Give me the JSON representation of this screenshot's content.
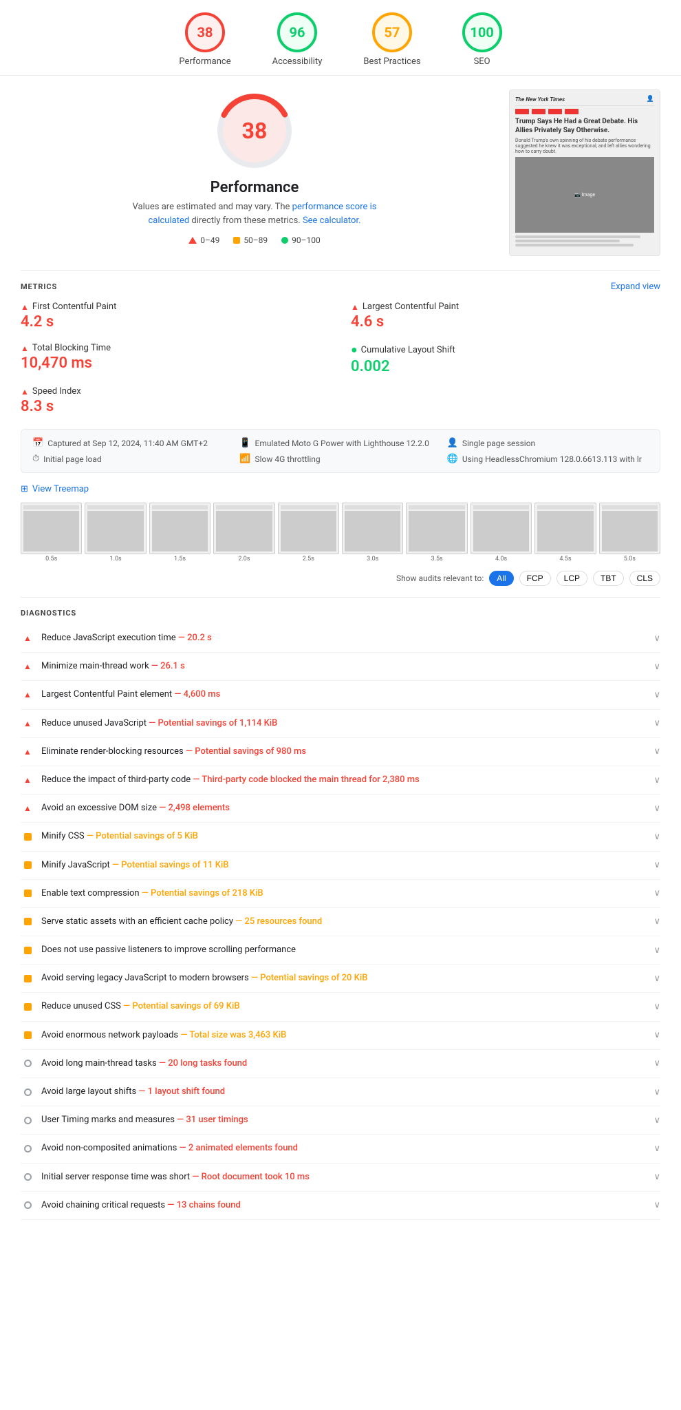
{
  "scores": [
    {
      "id": "performance",
      "value": "38",
      "label": "Performance",
      "type": "red"
    },
    {
      "id": "accessibility",
      "value": "96",
      "label": "Accessibility",
      "type": "green-light"
    },
    {
      "id": "best-practices",
      "value": "57",
      "label": "Best Practices",
      "type": "orange"
    },
    {
      "id": "seo",
      "value": "100",
      "label": "SEO",
      "type": "green"
    }
  ],
  "perf": {
    "score": "38",
    "title": "Performance",
    "desc1": "Values are estimated and may vary. The ",
    "desc_link1": "performance score is calculated",
    "desc2": " directly from these metrics. ",
    "desc_link2": "See calculator.",
    "legend": [
      {
        "type": "tri",
        "range": "0–49"
      },
      {
        "type": "sq-orange",
        "range": "50–89"
      },
      {
        "type": "dot-green",
        "range": "90–100"
      }
    ]
  },
  "metrics": {
    "title": "METRICS",
    "expand": "Expand view",
    "items": [
      {
        "name": "First Contentful Paint",
        "value": "4.2 s",
        "color": "red",
        "icon": "tri"
      },
      {
        "name": "Largest Contentful Paint",
        "value": "4.6 s",
        "color": "red",
        "icon": "tri"
      },
      {
        "name": "Total Blocking Time",
        "value": "10,470 ms",
        "color": "red",
        "icon": "tri"
      },
      {
        "name": "Cumulative Layout Shift",
        "value": "0.002",
        "color": "green",
        "icon": "dot"
      },
      {
        "name": "Speed Index",
        "value": "8.3 s",
        "color": "red",
        "icon": "tri"
      }
    ]
  },
  "infoBar": {
    "items": [
      {
        "icon": "📅",
        "text": "Captured at Sep 12, 2024, 11:40 AM GMT+2"
      },
      {
        "icon": "📱",
        "text": "Emulated Moto G Power with Lighthouse 12.2.0"
      },
      {
        "icon": "👤",
        "text": "Single page session"
      },
      {
        "icon": "⏱",
        "text": "Initial page load"
      },
      {
        "icon": "📶",
        "text": "Slow 4G throttling"
      },
      {
        "icon": "🌐",
        "text": "Using HeadlessChromium 128.0.6613.113 with lr"
      }
    ]
  },
  "treemap": {
    "label": "View Treemap"
  },
  "filmstrip": {
    "frames": [
      "0.5s",
      "1.0s",
      "1.5s",
      "2.0s",
      "2.5s",
      "3.0s",
      "3.5s",
      "4.0s",
      "4.5s",
      "5.0s"
    ]
  },
  "filterBar": {
    "label": "Show audits relevant to:",
    "buttons": [
      "All",
      "FCP",
      "LCP",
      "TBT",
      "CLS"
    ],
    "active": "All"
  },
  "diagnostics": {
    "title": "DIAGNOSTICS",
    "items": [
      {
        "icon": "tri-red",
        "text": "Reduce JavaScript execution time",
        "detail": " — 20.2 s",
        "detailColor": "red"
      },
      {
        "icon": "tri-red",
        "text": "Minimize main-thread work",
        "detail": " — 26.1 s",
        "detailColor": "red"
      },
      {
        "icon": "tri-red",
        "text": "Largest Contentful Paint element",
        "detail": " — 4,600 ms",
        "detailColor": "red"
      },
      {
        "icon": "tri-red",
        "text": "Reduce unused JavaScript",
        "detail": " — Potential savings of 1,114 KiB",
        "detailColor": "red"
      },
      {
        "icon": "tri-red",
        "text": "Eliminate render-blocking resources",
        "detail": " — Potential savings of 980 ms",
        "detailColor": "red"
      },
      {
        "icon": "tri-red",
        "text": "Reduce the impact of third-party code",
        "detail": " — Third-party code blocked the main thread for 2,380 ms",
        "detailColor": "red"
      },
      {
        "icon": "tri-red",
        "text": "Avoid an excessive DOM size",
        "detail": " — 2,498 elements",
        "detailColor": "red"
      },
      {
        "icon": "sq-orange",
        "text": "Minify CSS",
        "detail": " — Potential savings of 5 KiB",
        "detailColor": "orange"
      },
      {
        "icon": "sq-orange",
        "text": "Minify JavaScript",
        "detail": " — Potential savings of 11 KiB",
        "detailColor": "orange"
      },
      {
        "icon": "sq-orange",
        "text": "Enable text compression",
        "detail": " — Potential savings of 218 KiB",
        "detailColor": "orange"
      },
      {
        "icon": "sq-orange",
        "text": "Serve static assets with an efficient cache policy",
        "detail": " — 25 resources found",
        "detailColor": "orange"
      },
      {
        "icon": "sq-orange",
        "text": "Does not use passive listeners to improve scrolling performance",
        "detail": "",
        "detailColor": ""
      },
      {
        "icon": "sq-orange",
        "text": "Avoid serving legacy JavaScript to modern browsers",
        "detail": " — Potential savings of 20 KiB",
        "detailColor": "orange"
      },
      {
        "icon": "sq-orange",
        "text": "Reduce unused CSS",
        "detail": " — Potential savings of 69 KiB",
        "detailColor": "orange"
      },
      {
        "icon": "sq-orange",
        "text": "Avoid enormous network payloads",
        "detail": " — Total size was 3,463 KiB",
        "detailColor": "orange"
      },
      {
        "icon": "circle-gray",
        "text": "Avoid long main-thread tasks",
        "detail": " — 20 long tasks found",
        "detailColor": ""
      },
      {
        "icon": "circle-gray",
        "text": "Avoid large layout shifts",
        "detail": " — 1 layout shift found",
        "detailColor": ""
      },
      {
        "icon": "circle-gray",
        "text": "User Timing marks and measures",
        "detail": " — 31 user timings",
        "detailColor": ""
      },
      {
        "icon": "circle-gray",
        "text": "Avoid non-composited animations",
        "detail": " — 2 animated elements found",
        "detailColor": ""
      },
      {
        "icon": "circle-gray",
        "text": "Initial server response time was short",
        "detail": " — Root document took 10 ms",
        "detailColor": ""
      },
      {
        "icon": "circle-gray",
        "text": "Avoid chaining critical requests",
        "detail": " — 13 chains found",
        "detailColor": ""
      }
    ]
  }
}
